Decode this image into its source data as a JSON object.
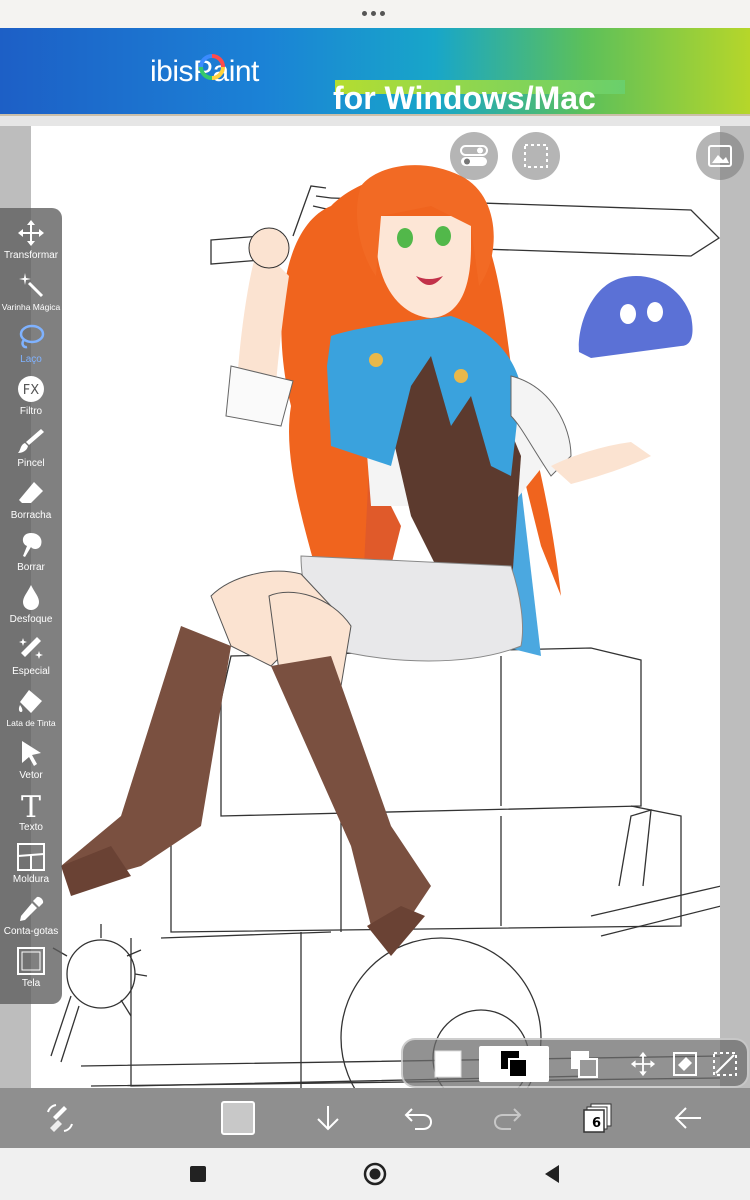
{
  "banner": {
    "brand_text": "ibisPaint",
    "tagline": "for Windows/Mac"
  },
  "tools": [
    {
      "label": "Transformar",
      "icon": "move-arrows-icon"
    },
    {
      "label": "Varinha Mágica",
      "icon": "magic-wand-icon"
    },
    {
      "label": "Laço",
      "icon": "lasso-icon"
    },
    {
      "label": "Filtro",
      "icon": "fx-icon"
    },
    {
      "label": "Pincel",
      "icon": "brush-icon"
    },
    {
      "label": "Borracha",
      "icon": "eraser-icon"
    },
    {
      "label": "Borrar",
      "icon": "smudge-icon"
    },
    {
      "label": "Desfoque",
      "icon": "blur-drop-icon"
    },
    {
      "label": "Especial",
      "icon": "sparkle-pen-icon"
    },
    {
      "label": "Lata de Tinta",
      "icon": "paint-bucket-icon"
    },
    {
      "label": "Vetor",
      "icon": "vector-pointer-icon"
    },
    {
      "label": "Texto",
      "icon": "text-icon"
    },
    {
      "label": "Moldura",
      "icon": "frame-divider-icon"
    },
    {
      "label": "Conta-gotas",
      "icon": "eyedropper-icon"
    },
    {
      "label": "Tela",
      "icon": "canvas-icon"
    }
  ],
  "active_tool": "Laço",
  "bottom": {
    "layer_count": "6"
  },
  "colors": {
    "accent": "#7fb2ff",
    "toolbar": "#5c5c5c",
    "bottom_bar": "#8f8f8f"
  }
}
